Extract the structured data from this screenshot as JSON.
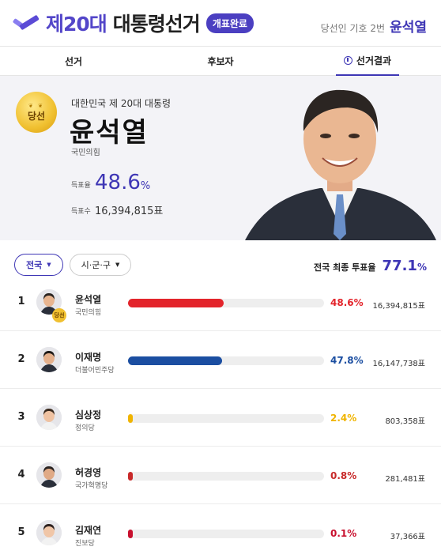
{
  "header": {
    "title_number": "제20대",
    "title_rest": "대통령선거",
    "status_badge": "개표완료",
    "winner_label": "당선인 기호 2번",
    "winner_name": "윤석열"
  },
  "tabs": [
    {
      "label": "선거",
      "active": false
    },
    {
      "label": "후보자",
      "active": false
    },
    {
      "label": "선거결과",
      "active": true,
      "icon": "ballot-icon"
    }
  ],
  "hero": {
    "medal_text": "당선",
    "subtitle": "대한민국 제 20대 대통령",
    "name": "윤석열",
    "party": "국민의힘",
    "rate_label": "득표율",
    "rate_value": "48.6",
    "rate_unit": "%",
    "votes_label": "득표수",
    "votes_value": "16,394,815표"
  },
  "filters": {
    "region": "전국",
    "district": "시·군·구",
    "turnout_label": "전국 최종 투표율",
    "turnout_value": "77.1",
    "turnout_unit": "%"
  },
  "candidates": [
    {
      "rank": "1",
      "name": "윤석열",
      "party": "국민의힘",
      "percent": "48.6%",
      "share": 48.6,
      "votes": "16,394,815표",
      "color": "#e3242b",
      "winner": true,
      "badge": "당선"
    },
    {
      "rank": "2",
      "name": "이재명",
      "party": "더불어민주당",
      "percent": "47.8%",
      "share": 47.8,
      "votes": "16,147,738표",
      "color": "#1b4ea1",
      "winner": false
    },
    {
      "rank": "3",
      "name": "심상정",
      "party": "정의당",
      "percent": "2.4%",
      "share": 2.4,
      "votes": "803,358표",
      "color": "#f0b400",
      "winner": false
    },
    {
      "rank": "4",
      "name": "허경영",
      "party": "국가혁명당",
      "percent": "0.8%",
      "share": 0.8,
      "votes": "281,481표",
      "color": "#c82a2a",
      "winner": false
    },
    {
      "rank": "5",
      "name": "김재연",
      "party": "진보당",
      "percent": "0.1%",
      "share": 0.1,
      "votes": "37,366표",
      "color": "#c8102e",
      "winner": false
    }
  ],
  "colors": {
    "accent": "#3e36b5",
    "hero_bg": "#f3f3f7"
  }
}
